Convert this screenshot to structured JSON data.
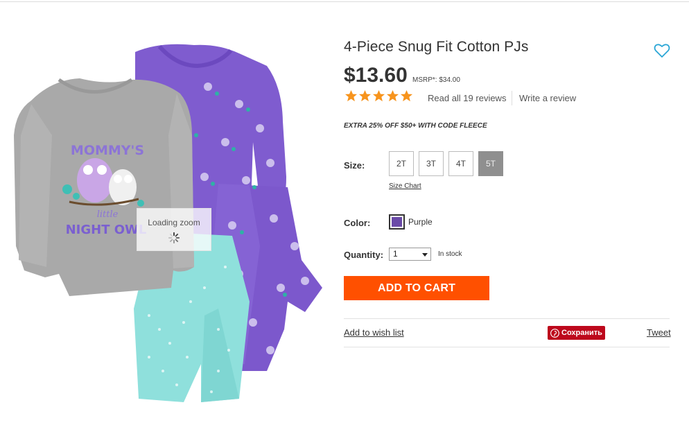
{
  "product": {
    "title": "4-Piece Snug Fit Cotton PJs",
    "price": "$13.60",
    "msrp": "MSRP*: $34.00",
    "rating_stars": 5,
    "reviews_link": "Read all 19 reviews",
    "write_review": "Write a review",
    "promo": "EXTRA 25% OFF $50+ WITH CODE FLEECE"
  },
  "image": {
    "shirt_text_1": "MOMMY'S",
    "shirt_text_2": "little",
    "shirt_text_3": "NIGHT OWL",
    "zoom_status": "Loading zoom"
  },
  "size": {
    "label": "Size:",
    "options": [
      "2T",
      "3T",
      "4T",
      "5T"
    ],
    "selected": "5T",
    "chart_link": "Size Chart"
  },
  "color": {
    "label": "Color:",
    "name": "Purple",
    "swatch_hex": "#6a4aa8"
  },
  "quantity": {
    "label": "Quantity:",
    "value": "1",
    "stock": "In stock"
  },
  "actions": {
    "add_to_cart": "ADD TO CART",
    "add_to_wishlist": "Add to wish list",
    "pinterest": "Сохранить",
    "tweet": "Tweet"
  },
  "colors": {
    "accent_orange": "#ff5000",
    "star_orange": "#f7941d",
    "pinterest_red": "#bd081c",
    "heart_blue": "#2aa6d6"
  }
}
